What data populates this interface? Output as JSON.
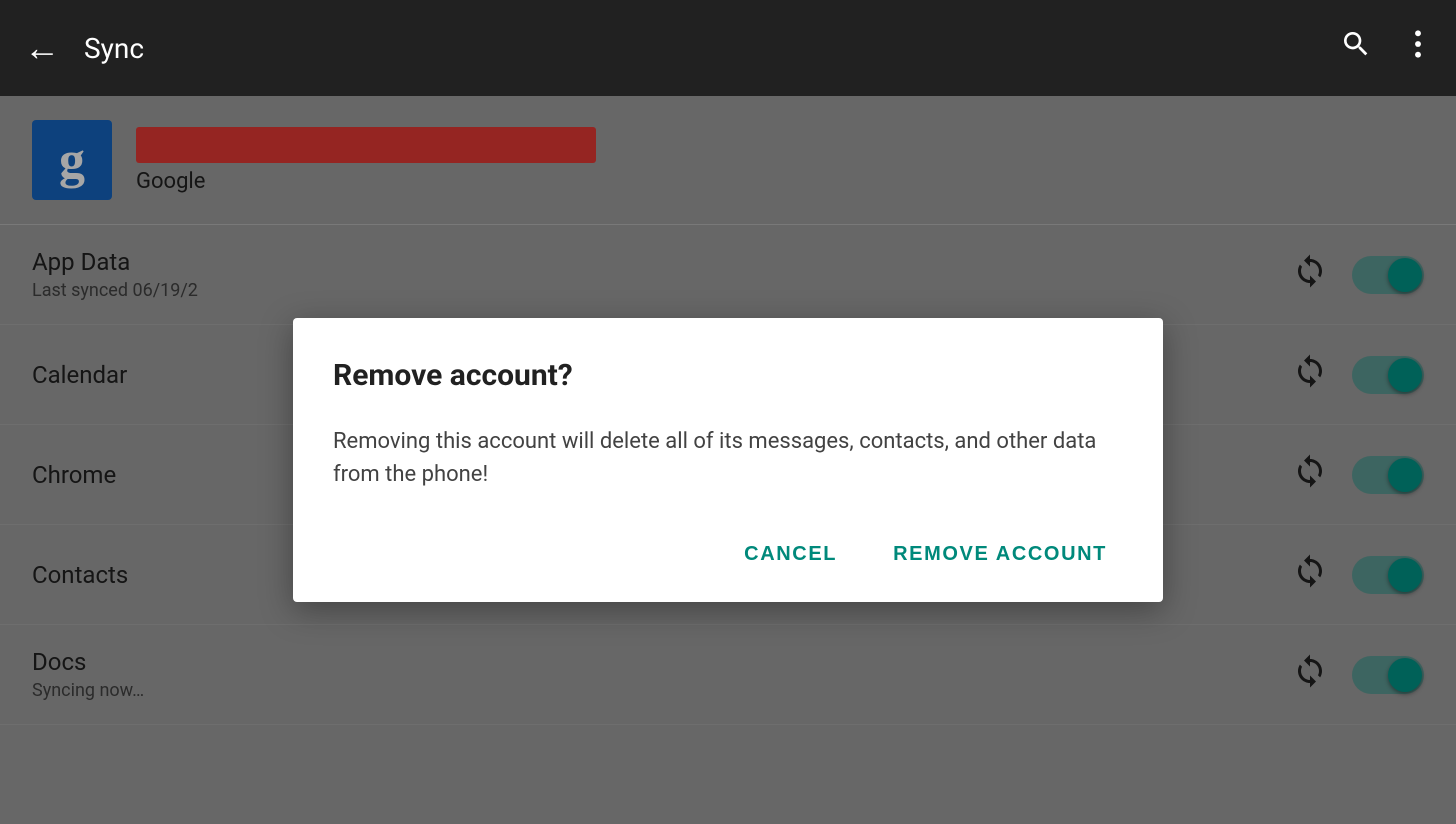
{
  "appBar": {
    "title": "Sync",
    "backLabel": "←",
    "searchIconLabel": "search",
    "moreIconLabel": "⋮"
  },
  "account": {
    "providerLabel": "Google",
    "emailRedacted": true
  },
  "syncItems": [
    {
      "name": "App Data",
      "sub": "Last synced 06/19/2",
      "syncing": false,
      "enabled": true
    },
    {
      "name": "Calendar",
      "sub": "",
      "syncing": false,
      "enabled": true
    },
    {
      "name": "Chrome",
      "sub": "",
      "syncing": false,
      "enabled": true
    },
    {
      "name": "Contacts",
      "sub": "",
      "syncing": false,
      "enabled": true
    },
    {
      "name": "Docs",
      "sub": "Syncing now…",
      "syncing": true,
      "enabled": true
    }
  ],
  "dialog": {
    "title": "Remove account?",
    "message": "Removing this account will delete all of its messages, contacts, and other data from the phone!",
    "cancelLabel": "CANCEL",
    "confirmLabel": "REMOVE ACCOUNT"
  },
  "colors": {
    "accent": "#00897B",
    "appBar": "#212121",
    "background": "#9e9e9e",
    "overlay": "rgba(0,0,0,0.35)"
  }
}
